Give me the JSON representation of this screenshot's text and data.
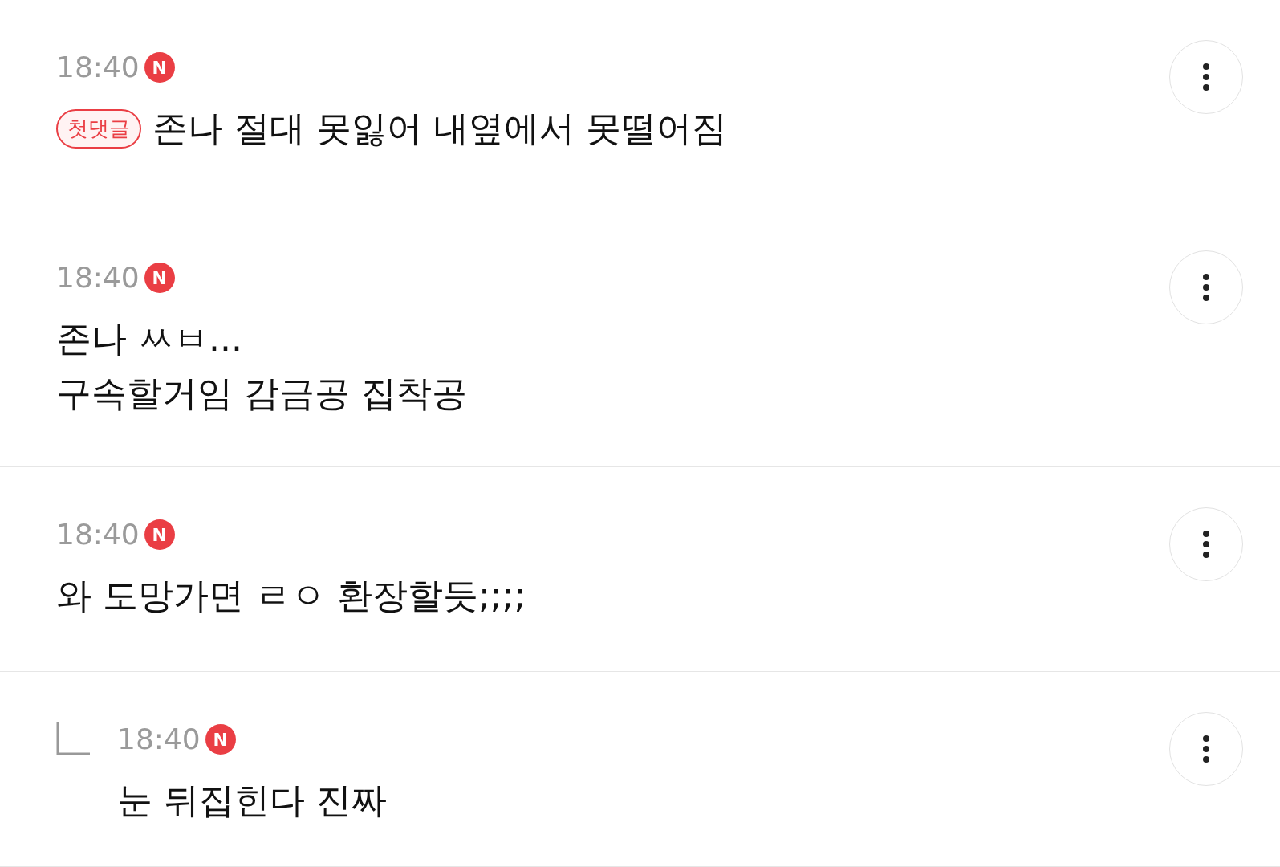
{
  "comments": [
    {
      "kind": "comment",
      "time": "18:40",
      "new_badge": "N",
      "tag": "첫댓글",
      "lines": [
        "존나 절대 못잃어 내옆에서 못떨어짐"
      ]
    },
    {
      "kind": "comment",
      "time": "18:40",
      "new_badge": "N",
      "lines": [
        "존나 ㅆㅂ...",
        "구속할거임 감금공 집착공"
      ]
    },
    {
      "kind": "comment",
      "time": "18:40",
      "new_badge": "N",
      "lines": [
        "와 도망가면 ㄹㅇ 환장할듯;;;;"
      ]
    },
    {
      "kind": "reply",
      "time": "18:40",
      "new_badge": "N",
      "lines": [
        "눈 뒤집힌다 진짜"
      ]
    }
  ]
}
